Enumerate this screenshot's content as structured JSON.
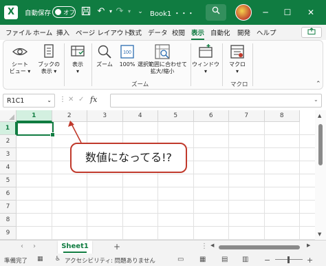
{
  "titlebar": {
    "app_logo": "X",
    "autosave_label": "自動保存",
    "autosave_toggle": "オフ",
    "icons": [
      "save-icon",
      "undo-icon",
      "redo-icon",
      "customize-icon"
    ],
    "title": "Book1 ・・・",
    "search_icon": "search-icon",
    "minimize": "─",
    "maximize": "☐",
    "close": "✕",
    "color": "#107c41"
  },
  "menu": {
    "items": [
      "ファイル",
      "ホーム",
      "挿入",
      "ページ レイアウト",
      "数式",
      "データ",
      "校閲",
      "表示",
      "自動化",
      "開発",
      "ヘルプ"
    ],
    "active": "表示",
    "share_icon": "share-icon"
  },
  "ribbon": {
    "buttons": {
      "sheet_view": "シート\nビュー ▾",
      "workbook_view": "ブックの\n表示 ▾",
      "show": "表示\n▾",
      "zoom": "ズーム",
      "zoom100": "100%",
      "zoom_selection": "選択範囲に合わせて\n拡大/縮小",
      "window": "ウィンドウ\n▾",
      "macro": "マクロ\n▾"
    },
    "groups": {
      "zoom": "ズーム",
      "macro": "マクロ"
    },
    "collapse_caret": "⌃"
  },
  "formula_bar": {
    "name_box": "R1C1",
    "fx": "fx",
    "value": ""
  },
  "grid": {
    "columns": [
      "1",
      "2",
      "3",
      "4",
      "5",
      "6",
      "7",
      "8"
    ],
    "rows": [
      "1",
      "2",
      "3",
      "4",
      "5",
      "6",
      "7",
      "8",
      "9"
    ],
    "selected_column": "1",
    "selected_row": "1"
  },
  "callout": {
    "text": "数値になってる!?",
    "border_color": "#c0392b"
  },
  "sheets": {
    "tabs": [
      "Sheet1"
    ],
    "add": "+"
  },
  "status": {
    "ready": "準備完了",
    "accessibility": "アクセシビリティ: 問題ありません"
  }
}
